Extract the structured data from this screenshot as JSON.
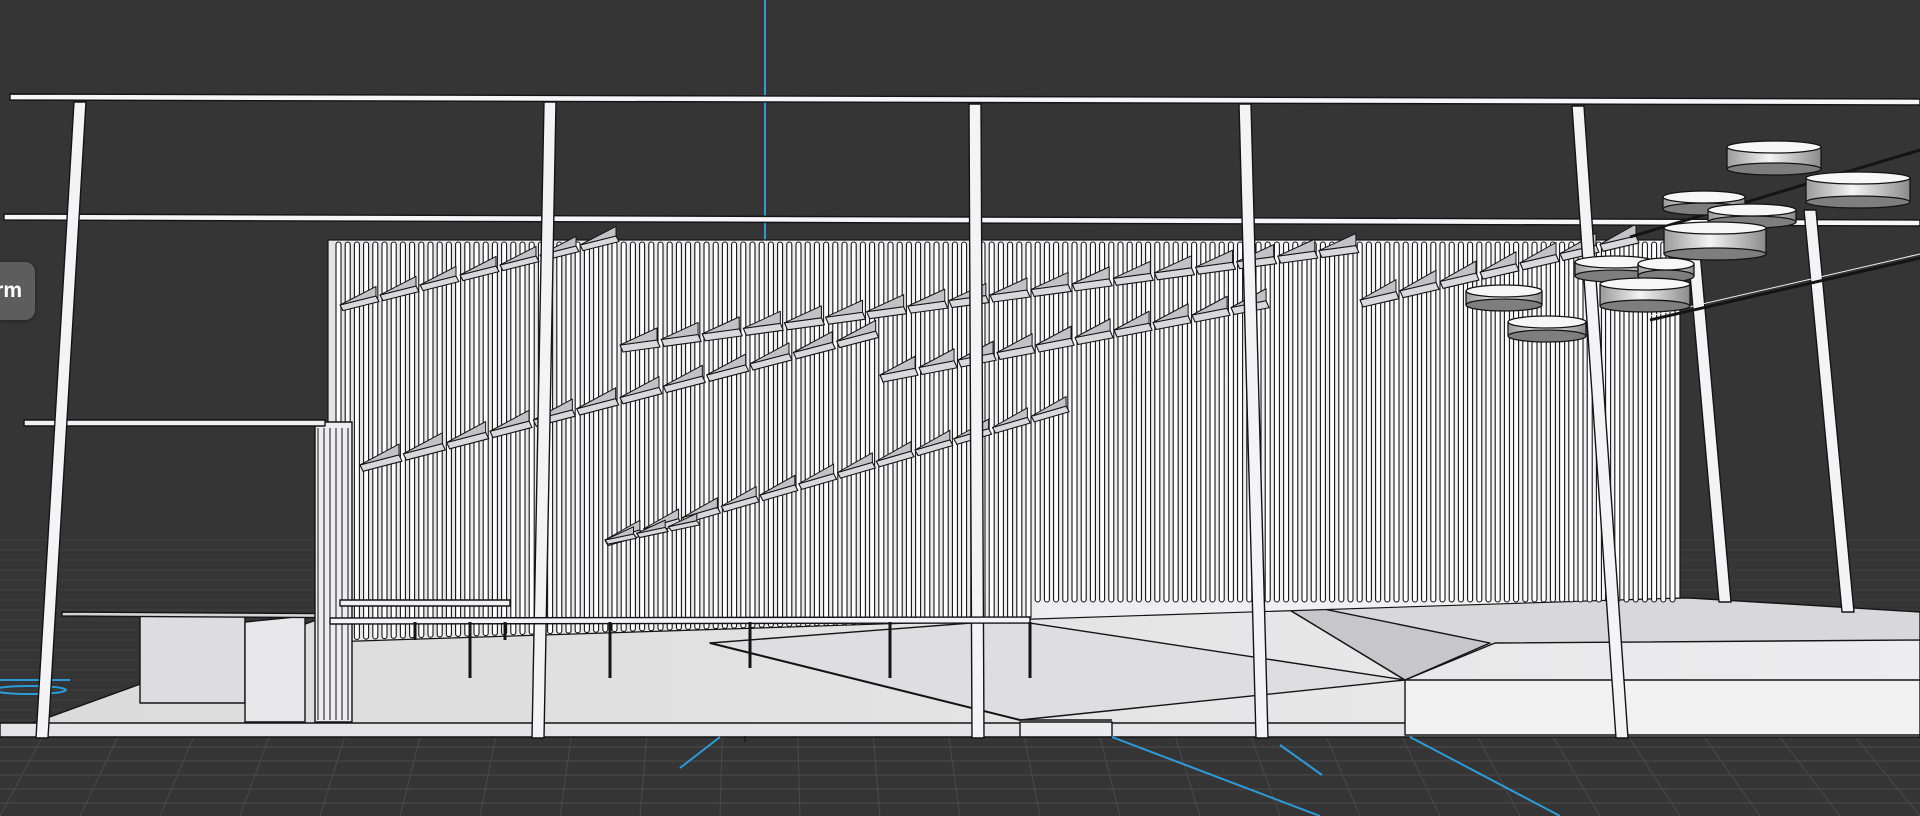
{
  "viewport": {
    "background_color": "#353535",
    "grid_color": "#4a4a4a",
    "axis_color": "#2e9bd9",
    "model_color": "#f2f2f4",
    "edge_color": "#141414"
  },
  "toolbar": {
    "partial_tab_label": "rm"
  }
}
